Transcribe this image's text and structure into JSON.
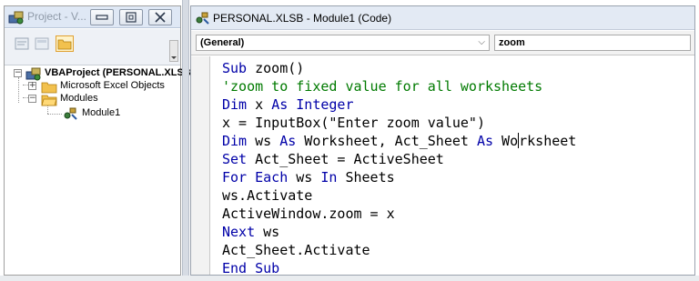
{
  "project_explorer": {
    "title": "Project - V...",
    "tree": {
      "root": "VBAProject (PERSONAL.XLSB",
      "excel_objects": "Microsoft Excel Objects",
      "modules": "Modules",
      "module1": "Module1"
    },
    "expanders": {
      "root": "−",
      "excel_objects": "+",
      "modules": "−"
    }
  },
  "code_window": {
    "title": "PERSONAL.XLSB - Module1 (Code)",
    "object_combo": "(General)",
    "proc_combo": "zoom",
    "combo_arrow": "⌵",
    "lines": {
      "l1_kw": "Sub",
      "l1_rest": " zoom()",
      "l2_comment": "'zoom to fixed value for all worksheets",
      "l3_kw1": "Dim",
      "l3_mid": " x ",
      "l3_kw2": "As",
      "l3_mid2": " ",
      "l3_kw3": "Integer",
      "l4": "x = InputBox(\"Enter zoom value\")",
      "l5_kw1": "Dim",
      "l5_a": " ws ",
      "l5_kw2": "As",
      "l5_b": " Worksheet, Act_Sheet ",
      "l5_kw3": "As",
      "l5_c1": " Wo",
      "l5_c2": "rksheet",
      "l6_kw": "Set",
      "l6_rest": " Act_Sheet = ActiveSheet",
      "l7_kw1": "For",
      "l7_a": " ",
      "l7_kw2": "Each",
      "l7_b": " ws ",
      "l7_kw3": "In",
      "l7_c": " Sheets",
      "l8": "ws.Activate",
      "l9": "ActiveWindow.zoom = x",
      "l10_kw": "Next",
      "l10_rest": " ws",
      "l11": "Act_Sheet.Activate",
      "l12_kw1": "End",
      "l12_a": " ",
      "l12_kw2": "Sub"
    }
  },
  "colors": {
    "keyword": "#0000a8",
    "comment": "#007a00",
    "title_bar": "#e3eaf4"
  }
}
